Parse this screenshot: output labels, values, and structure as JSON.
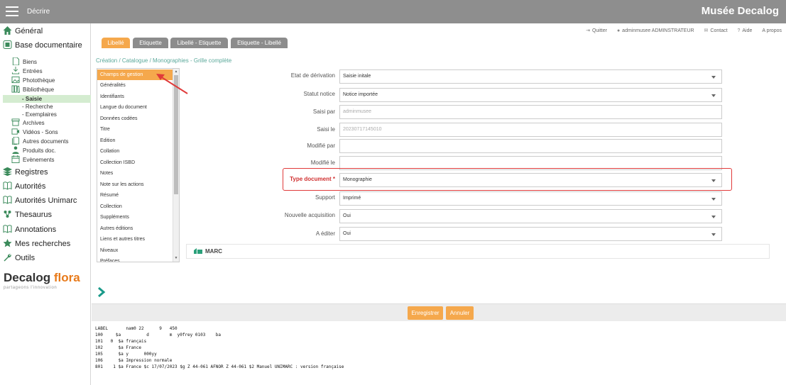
{
  "header": {
    "menu_label": "Décrire",
    "app_title": "Musée Decalog"
  },
  "sidebar": {
    "main": [
      {
        "label": "Général",
        "icon": "home-icon"
      },
      {
        "label": "Base documentaire",
        "icon": "database-icon"
      },
      {
        "label": "Registres",
        "icon": "registers-icon"
      },
      {
        "label": "Autorités",
        "icon": "book-open-icon"
      },
      {
        "label": "Autorités Unimarc",
        "icon": "book-open-icon"
      },
      {
        "label": "Thesaurus",
        "icon": "thesaurus-icon"
      },
      {
        "label": "Annotations",
        "icon": "book-open-icon"
      },
      {
        "label": "Mes recherches",
        "icon": "star-icon"
      },
      {
        "label": "Outils",
        "icon": "wrench-icon"
      }
    ],
    "sub": [
      {
        "label": "Biens",
        "icon": "document-icon"
      },
      {
        "label": "Entrées",
        "icon": "download-icon"
      },
      {
        "label": "Photothèque",
        "icon": "photo-icon"
      },
      {
        "label": "Bibliothèque",
        "icon": "library-icon"
      },
      {
        "label": "Archives",
        "icon": "archive-icon"
      },
      {
        "label": "Vidéos - Sons",
        "icon": "video-icon"
      },
      {
        "label": "Autres documents",
        "icon": "documents-icon"
      },
      {
        "label": "Produits doc.",
        "icon": "people-icon"
      },
      {
        "label": "Evènements",
        "icon": "calendar-icon"
      }
    ],
    "sub2": [
      "- Saisie",
      "- Recherche",
      "- Exemplaires"
    ],
    "logo": {
      "brand": "Decalog",
      "accent": "flora",
      "tagline": "partageons l'innovation"
    }
  },
  "toplinks": [
    {
      "label": "Quitter",
      "icon": "exit-icon"
    },
    {
      "label": "adminmusee ADMINSTRATEUR",
      "icon": "user-icon"
    },
    {
      "label": "Contact",
      "icon": "mail-icon"
    },
    {
      "label": "Aide",
      "icon": "help-icon"
    },
    {
      "label": "A propos",
      "icon": ""
    }
  ],
  "tabs": [
    "Libellé",
    "Etiquette",
    "Libellé - Etiquette",
    "Etiquette - Libellé"
  ],
  "breadcrumb": "Création / Catalogue / Monographies - Grille complète",
  "fieldlist": [
    "Champs de gestion",
    "Généralités",
    "Identifiants",
    "Langue du document",
    "Données codées",
    "Titre",
    "Edition",
    "Collation",
    "Collection ISBD",
    "Notes",
    "Note sur les actions",
    "Résumé",
    "Collection",
    "Suppléments",
    "Autres éditions",
    "Liens et autres titres",
    "Niveaux",
    "Préfaces"
  ],
  "form": [
    {
      "label": "Etat de dérivation",
      "value": "Saisie initale",
      "kind": "select"
    },
    {
      "label": "Statut notice",
      "value": "Notice importée",
      "kind": "select"
    },
    {
      "label": "Saisi par",
      "value": "adminmusee",
      "kind": "readonly"
    },
    {
      "label": "Saisi le",
      "value": "20230717145010",
      "kind": "readonly"
    },
    {
      "label": "Modifié par",
      "value": "",
      "kind": "input"
    },
    {
      "label": "Modifié le",
      "value": "",
      "kind": "input"
    },
    {
      "label": "Type document",
      "required_mark": "*",
      "value": "Monographie",
      "kind": "select"
    },
    {
      "label": "Support",
      "value": "Imprimé",
      "kind": "select"
    },
    {
      "label": "Nouvelle acquisition",
      "value": "Oui",
      "kind": "select"
    },
    {
      "label": "A éditer",
      "value": "Oui",
      "kind": "select"
    }
  ],
  "marc_section": "MARC",
  "buttons": {
    "save": "Enregistrer",
    "cancel": "Annuler"
  },
  "marc_lines": [
    "LABEL       nam0 22      9   450",
    "100     $a          d        m  y0frey 0103    ba",
    "101   0  $a français",
    "102      $a France",
    "105      $a y      000yy",
    "106      $a Impression normale",
    "801    1 $a France $c 17/07/2023 $g Z 44-061 AFNOR Z 44-061 $2 Manuel UNIMARC : version française"
  ],
  "colors": {
    "accent": "#f5a84c",
    "header": "#8e8e8e",
    "sidebar_icon": "#3a8a5a",
    "required": "#d03030",
    "breadcrumb": "#5aa89a"
  }
}
